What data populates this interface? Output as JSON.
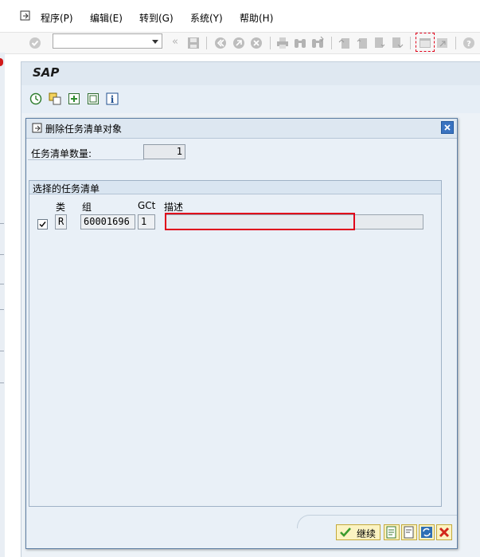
{
  "menu": {
    "items": [
      {
        "label": "程序(P)"
      },
      {
        "label": "编辑(E)"
      },
      {
        "label": "转到(G)"
      },
      {
        "label": "系统(Y)"
      },
      {
        "label": "帮助(H)"
      }
    ]
  },
  "toolbar": {
    "command_value": ""
  },
  "sap": {
    "title": "SAP"
  },
  "dialog": {
    "title": "删除任务清单对象",
    "count_label": "任务清单数量:",
    "count_value": "1",
    "group_title": "选择的任务清单",
    "columns": {
      "type": "类",
      "group": "组",
      "gct": "GCt",
      "desc": "描述"
    },
    "row": {
      "checked": true,
      "type": "R",
      "group": "60001696",
      "gct": "1",
      "desc": ""
    },
    "continue_label": "继续"
  },
  "colors": {
    "highlight": "#e0001a",
    "dialog_border": "#5d7ea3",
    "button_fill": "#fbf3c2"
  }
}
